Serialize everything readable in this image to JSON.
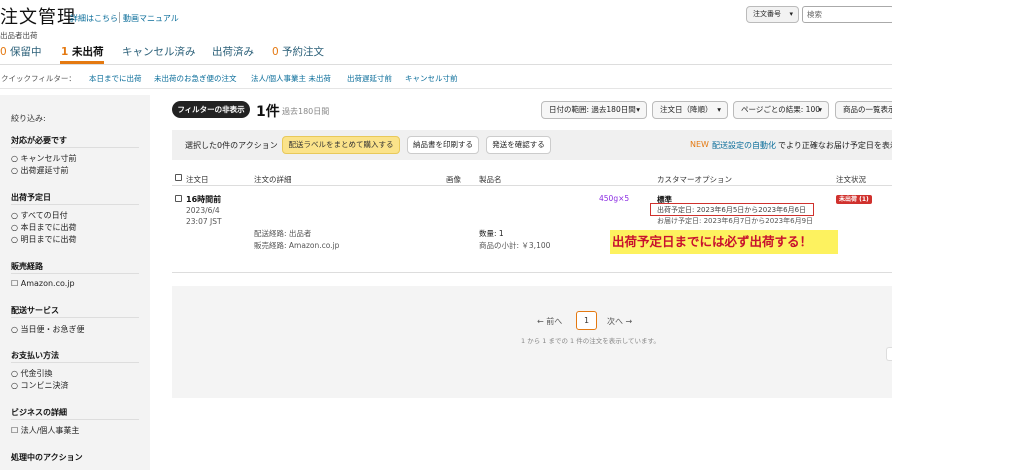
{
  "header": {
    "title": "注文管理",
    "link_details": "詳細はこちら",
    "link_video": "動画マニュアル",
    "subtitle": "出品者出荷",
    "search_type": "注文番号",
    "search_placeholder": "検索"
  },
  "tabs": [
    {
      "count": "0",
      "label": "保留中"
    },
    {
      "count": "1",
      "label": "未出荷"
    },
    {
      "count": "",
      "label": "キャンセル済み"
    },
    {
      "count": "",
      "label": "出荷済み"
    },
    {
      "count": "0",
      "label": "予約注文"
    }
  ],
  "quick_filter": {
    "label": "クイックフィルター：",
    "items": [
      "本日までに出荷",
      "未出荷のお急ぎ便の注文",
      "法人/個人事業主 未出荷",
      "出荷遅延寸前",
      "キャンセル寸前"
    ]
  },
  "sidebar": {
    "title": "絞り込み:",
    "sections": [
      {
        "heading": "対応が必要です",
        "items": [
          "○ キャンセル寸前",
          "○ 出荷遅延寸前"
        ]
      },
      {
        "heading": "出荷予定日",
        "items": [
          "○ すべての日付",
          "○ 本日までに出荷",
          "○ 明日までに出荷"
        ]
      },
      {
        "heading": "販売経路",
        "items": [
          "☐ Amazon.co.jp"
        ]
      },
      {
        "heading": "配送サービス",
        "items": [
          "○ 当日便・お急ぎ便"
        ]
      },
      {
        "heading": "お支払い方法",
        "items": [
          "○ 代金引換",
          "○ コンビニ決済"
        ]
      },
      {
        "heading": "ビジネスの詳細",
        "items": [
          "☐ 法人/個人事業主"
        ]
      },
      {
        "heading": "処理中のアクション",
        "items": []
      }
    ]
  },
  "toolbar": {
    "filter_toggle": "フィルターの非表示",
    "count": "1件",
    "count_sub": "過去180日間",
    "date_range": "日付の範囲: 過去180日間",
    "sort": "注文日（降順）",
    "per_page": "ページごとの結果: 100",
    "list_view": "商品の一覧表示"
  },
  "actionbar": {
    "label": "選択した0件のアクション",
    "buy_labels": "配送ラベルをまとめて購入する",
    "print_slip": "納品書を印刷する",
    "confirm_ship": "発送を確認する",
    "new_tag": "NEW",
    "auto_link": "配送設定の自動化",
    "auto_rest": "でより正確なお届け予定日を表示"
  },
  "table": {
    "headers": [
      "注文日",
      "注文の詳細",
      "画像",
      "製品名",
      "カスタマーオプション",
      "注文状況"
    ],
    "row": {
      "relative_time": "16時間前",
      "date": "2023/6/4",
      "time": "23:07 JST",
      "fulfillment": "配送経路: 出品者",
      "channel": "販売経路: Amazon.co.jp",
      "variant": "450g×5",
      "quantity": "数量: 1",
      "subtotal": "商品の小計: ￥3,100",
      "shipping_option": "標準",
      "ship_by": "出荷予定日: 2023年6月5日から2023年6月6日",
      "deliver_by": "お届け予定日: 2023年6月7日から2023年6月9日",
      "status": "未出荷 (1)"
    }
  },
  "annotation": "出荷予定日までには必ず出荷する！",
  "pagination": {
    "prev": "← 前へ",
    "page": "1",
    "next": "次へ →",
    "note": "1 から 1 までの 1 件の注文を表示しています。"
  }
}
